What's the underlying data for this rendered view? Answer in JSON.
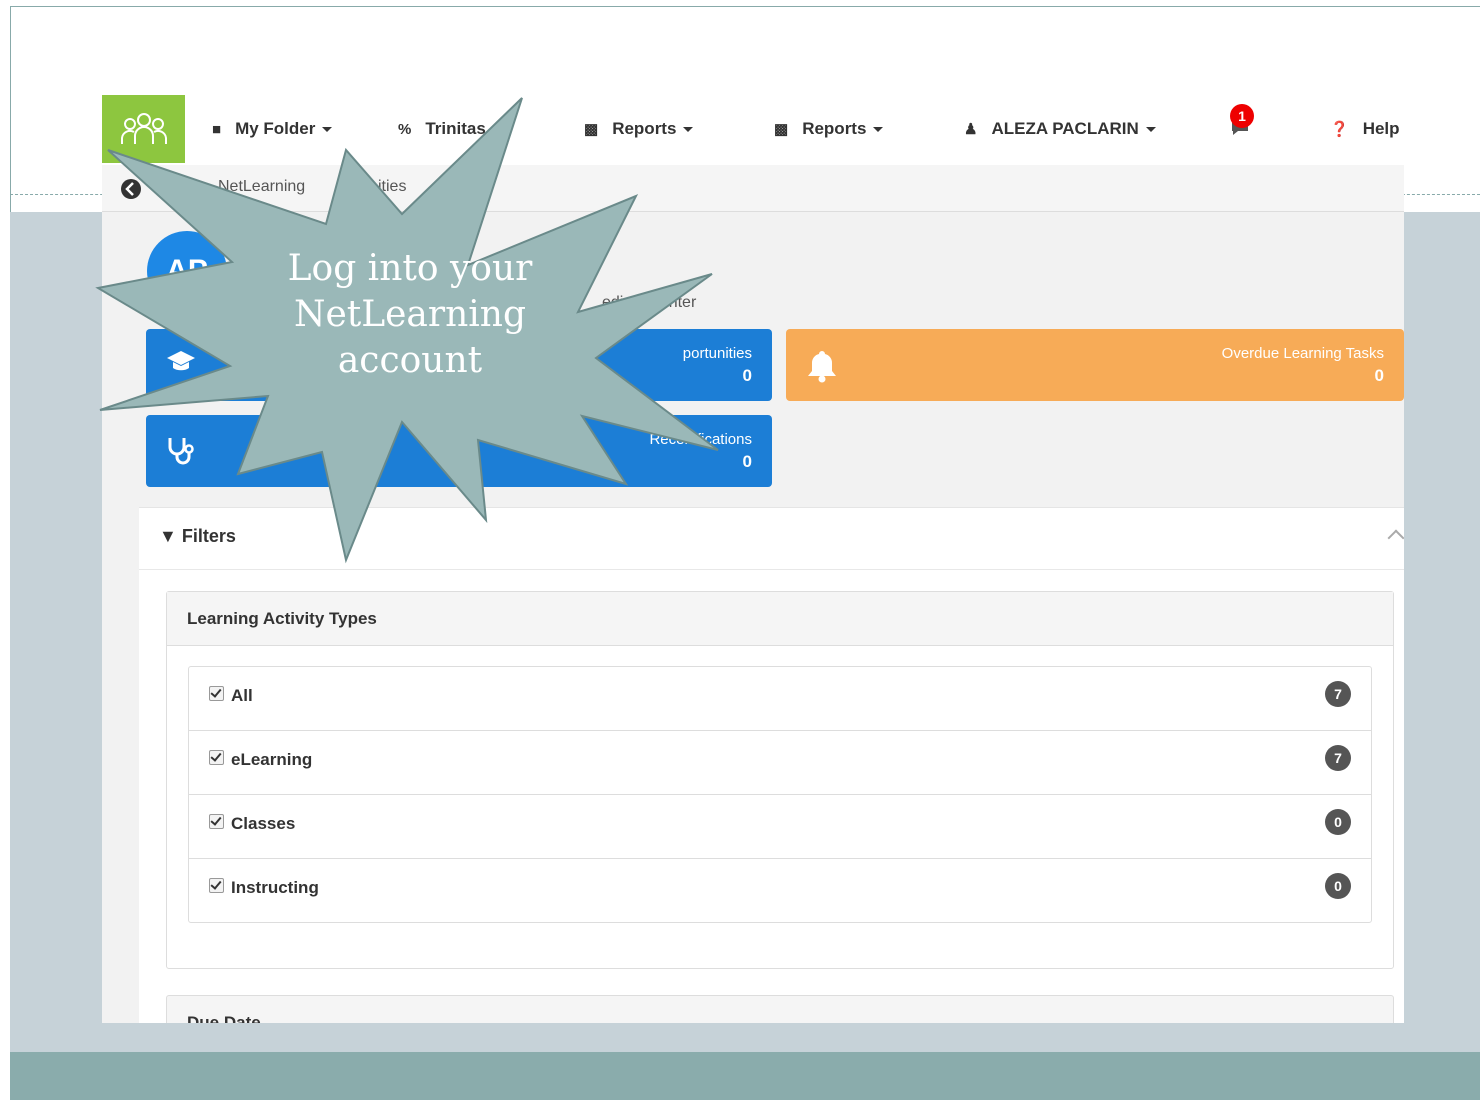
{
  "nav": {
    "my_folder": "My Folder",
    "trinitas": "Trinitas",
    "reports1": "Reports",
    "reports2": "Reports",
    "user": "ALEZA PACLARIN",
    "notifications": "1",
    "help": "Help"
  },
  "breadcrumb": {
    "item1": "NetLearning",
    "item2": "ities"
  },
  "profile": {
    "avatar_initials": "AP",
    "org": "edical Center"
  },
  "tiles": {
    "opportunities_label": "portunities",
    "opportunities_value": "0",
    "overdue_label": "Overdue Learning Tasks",
    "overdue_value": "0",
    "recert_label": "Recertifications",
    "recert_value": "0"
  },
  "filters": {
    "title": "Filters",
    "lat_title": "Learning Activity Types",
    "rows": [
      {
        "label": "All",
        "count": "7"
      },
      {
        "label": "eLearning",
        "count": "7"
      },
      {
        "label": "Classes",
        "count": "0"
      },
      {
        "label": "Instructing",
        "count": "0"
      }
    ],
    "due_title": "Due Date"
  },
  "callout": {
    "line1": "Log into your",
    "line2": "NetLearning",
    "line3": "account"
  },
  "colors": {
    "brand_green": "#8dc63f",
    "tile_blue": "#1c7ed6",
    "tile_orange": "#f7ab57",
    "callout_fill": "#9ab8b8"
  }
}
